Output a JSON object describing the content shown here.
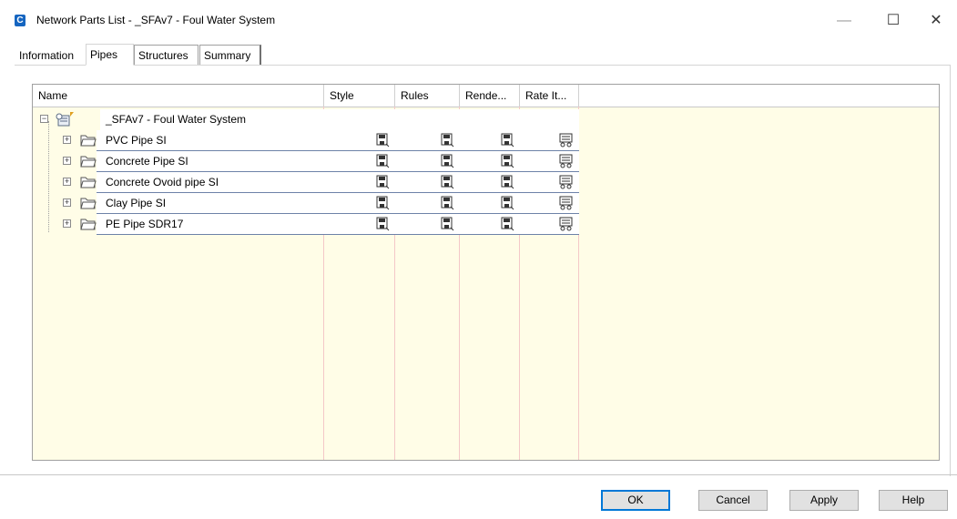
{
  "window": {
    "title": "Network Parts List - _SFAv7 - Foul Water System",
    "app_icon": "C",
    "minimize_glyph": "—",
    "maximize_glyph": "☐",
    "close_glyph": "✕"
  },
  "tabs": [
    {
      "label": "Information"
    },
    {
      "label": "Pipes"
    },
    {
      "label": "Structures"
    },
    {
      "label": "Summary"
    }
  ],
  "grid": {
    "columns": [
      {
        "label": "Name"
      },
      {
        "label": "Style"
      },
      {
        "label": "Rules"
      },
      {
        "label": "Rende..."
      },
      {
        "label": "Rate It..."
      }
    ],
    "root": {
      "label": "_SFAv7 - Foul Water System"
    },
    "rows": [
      {
        "label": "PVC Pipe SI"
      },
      {
        "label": "Concrete Pipe SI"
      },
      {
        "label": "Concrete Ovoid pipe SI"
      },
      {
        "label": "Clay Pipe SI"
      },
      {
        "label": "PE Pipe SDR17"
      }
    ]
  },
  "buttons": {
    "ok": "OK",
    "cancel": "Cancel",
    "apply": "Apply",
    "help": "Help"
  },
  "colors": {
    "grid_background": "#fffde7",
    "accent": "#0078d7",
    "app_icon": "#1565c0"
  }
}
